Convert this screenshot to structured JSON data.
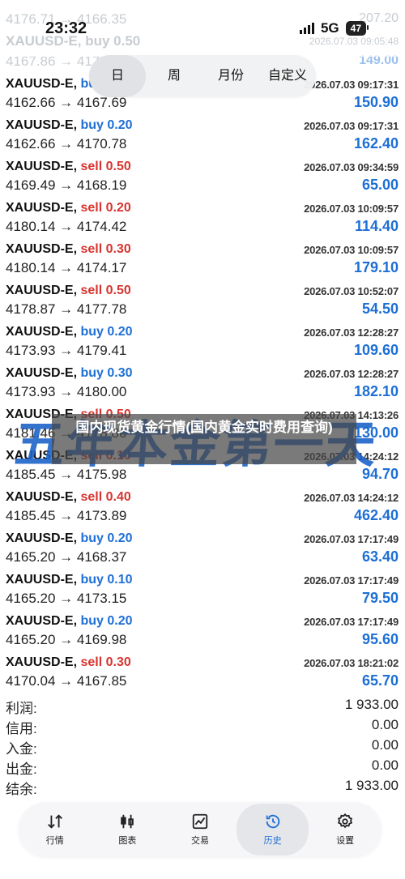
{
  "status_bar": {
    "time": "23:32",
    "network": "5G",
    "battery": "47"
  },
  "top_faded": [
    {
      "left": "4176.71 → 4166.35",
      "right": "207.20"
    },
    {
      "left": "XAUUSD-E, buy 0.50",
      "right": "2026.07.03 09:05:48"
    },
    {
      "left": "4167.86 → 4177.06",
      "right": "149.00"
    }
  ],
  "tabs": [
    "日",
    "周",
    "月份",
    "自定义"
  ],
  "trades": [
    {
      "symbol": "XAUUSD-E,",
      "side": "buy",
      "size": "0.20",
      "date": "2026.07.03 09:17:31",
      "prices": "4162.66 → 4167.69",
      "profit": "150.90"
    },
    {
      "symbol": "XAUUSD-E,",
      "side": "buy",
      "size": "0.20",
      "date": "2026.07.03 09:17:31",
      "prices": "4162.66 → 4170.78",
      "profit": "162.40"
    },
    {
      "symbol": "XAUUSD-E,",
      "side": "sell",
      "size": "0.50",
      "date": "2026.07.03 09:34:59",
      "prices": "4169.49 → 4168.19",
      "profit": "65.00"
    },
    {
      "symbol": "XAUUSD-E,",
      "side": "sell",
      "size": "0.20",
      "date": "2026.07.03 10:09:57",
      "prices": "4180.14 → 4174.42",
      "profit": "114.40"
    },
    {
      "symbol": "XAUUSD-E,",
      "side": "sell",
      "size": "0.30",
      "date": "2026.07.03 10:09:57",
      "prices": "4180.14 → 4174.17",
      "profit": "179.10"
    },
    {
      "symbol": "XAUUSD-E,",
      "side": "sell",
      "size": "0.50",
      "date": "2026.07.03 10:52:07",
      "prices": "4178.87 → 4177.78",
      "profit": "54.50"
    },
    {
      "symbol": "XAUUSD-E,",
      "side": "buy",
      "size": "0.20",
      "date": "2026.07.03 12:28:27",
      "prices": "4173.93 → 4179.41",
      "profit": "109.60"
    },
    {
      "symbol": "XAUUSD-E,",
      "side": "buy",
      "size": "0.30",
      "date": "2026.07.03 12:28:27",
      "prices": "4173.93 → 4180.00",
      "profit": "182.10"
    },
    {
      "symbol": "XAUUSD-E,",
      "side": "sell",
      "size": "0.50",
      "date": "2026.07.03 14:13:26",
      "prices": "4181.46 → 4178.86",
      "profit": "130.00"
    },
    {
      "symbol": "XAUUSD-E,",
      "side": "sell",
      "size": "0.10",
      "date": "2026.07.03 14:24:12",
      "prices": "4185.45 → 4175.98",
      "profit": "94.70"
    },
    {
      "symbol": "XAUUSD-E,",
      "side": "sell",
      "size": "0.40",
      "date": "2026.07.03 14:24:12",
      "prices": "4185.45 → 4173.89",
      "profit": "462.40"
    },
    {
      "symbol": "XAUUSD-E,",
      "side": "buy",
      "size": "0.20",
      "date": "2026.07.03 17:17:49",
      "prices": "4165.20 → 4168.37",
      "profit": "63.40"
    },
    {
      "symbol": "XAUUSD-E,",
      "side": "buy",
      "size": "0.10",
      "date": "2026.07.03 17:17:49",
      "prices": "4165.20 → 4173.15",
      "profit": "79.50"
    },
    {
      "symbol": "XAUUSD-E,",
      "side": "buy",
      "size": "0.20",
      "date": "2026.07.03 17:17:49",
      "prices": "4165.20 → 4169.98",
      "profit": "95.60"
    },
    {
      "symbol": "XAUUSD-E,",
      "side": "sell",
      "size": "0.30",
      "date": "2026.07.03 18:21:02",
      "prices": "4170.04 → 4167.85",
      "profit": "65.70"
    }
  ],
  "summary": [
    {
      "label": "利润:",
      "value": "1 933.00"
    },
    {
      "label": "信用:",
      "value": "0.00"
    },
    {
      "label": "入金:",
      "value": "0.00"
    },
    {
      "label": "出金:",
      "value": "0.00"
    },
    {
      "label": "结余:",
      "value": "1 933.00"
    }
  ],
  "nav": [
    {
      "label": "行情",
      "icon": "quotes-arrows-icon"
    },
    {
      "label": "图表",
      "icon": "candlestick-chart-icon"
    },
    {
      "label": "交易",
      "icon": "trade-chart-icon"
    },
    {
      "label": "历史",
      "icon": "history-clock-icon"
    },
    {
      "label": "设置",
      "icon": "gear-icon"
    }
  ],
  "overlay_title": "国内现货黄金行情(国内黄金实时费用查询)",
  "watermark": "五年本金第一天",
  "colors": {
    "buy": "#1d6fd6",
    "sell": "#d7342f",
    "profit": "#1d6fd6",
    "watermark": "#1e63c8"
  }
}
